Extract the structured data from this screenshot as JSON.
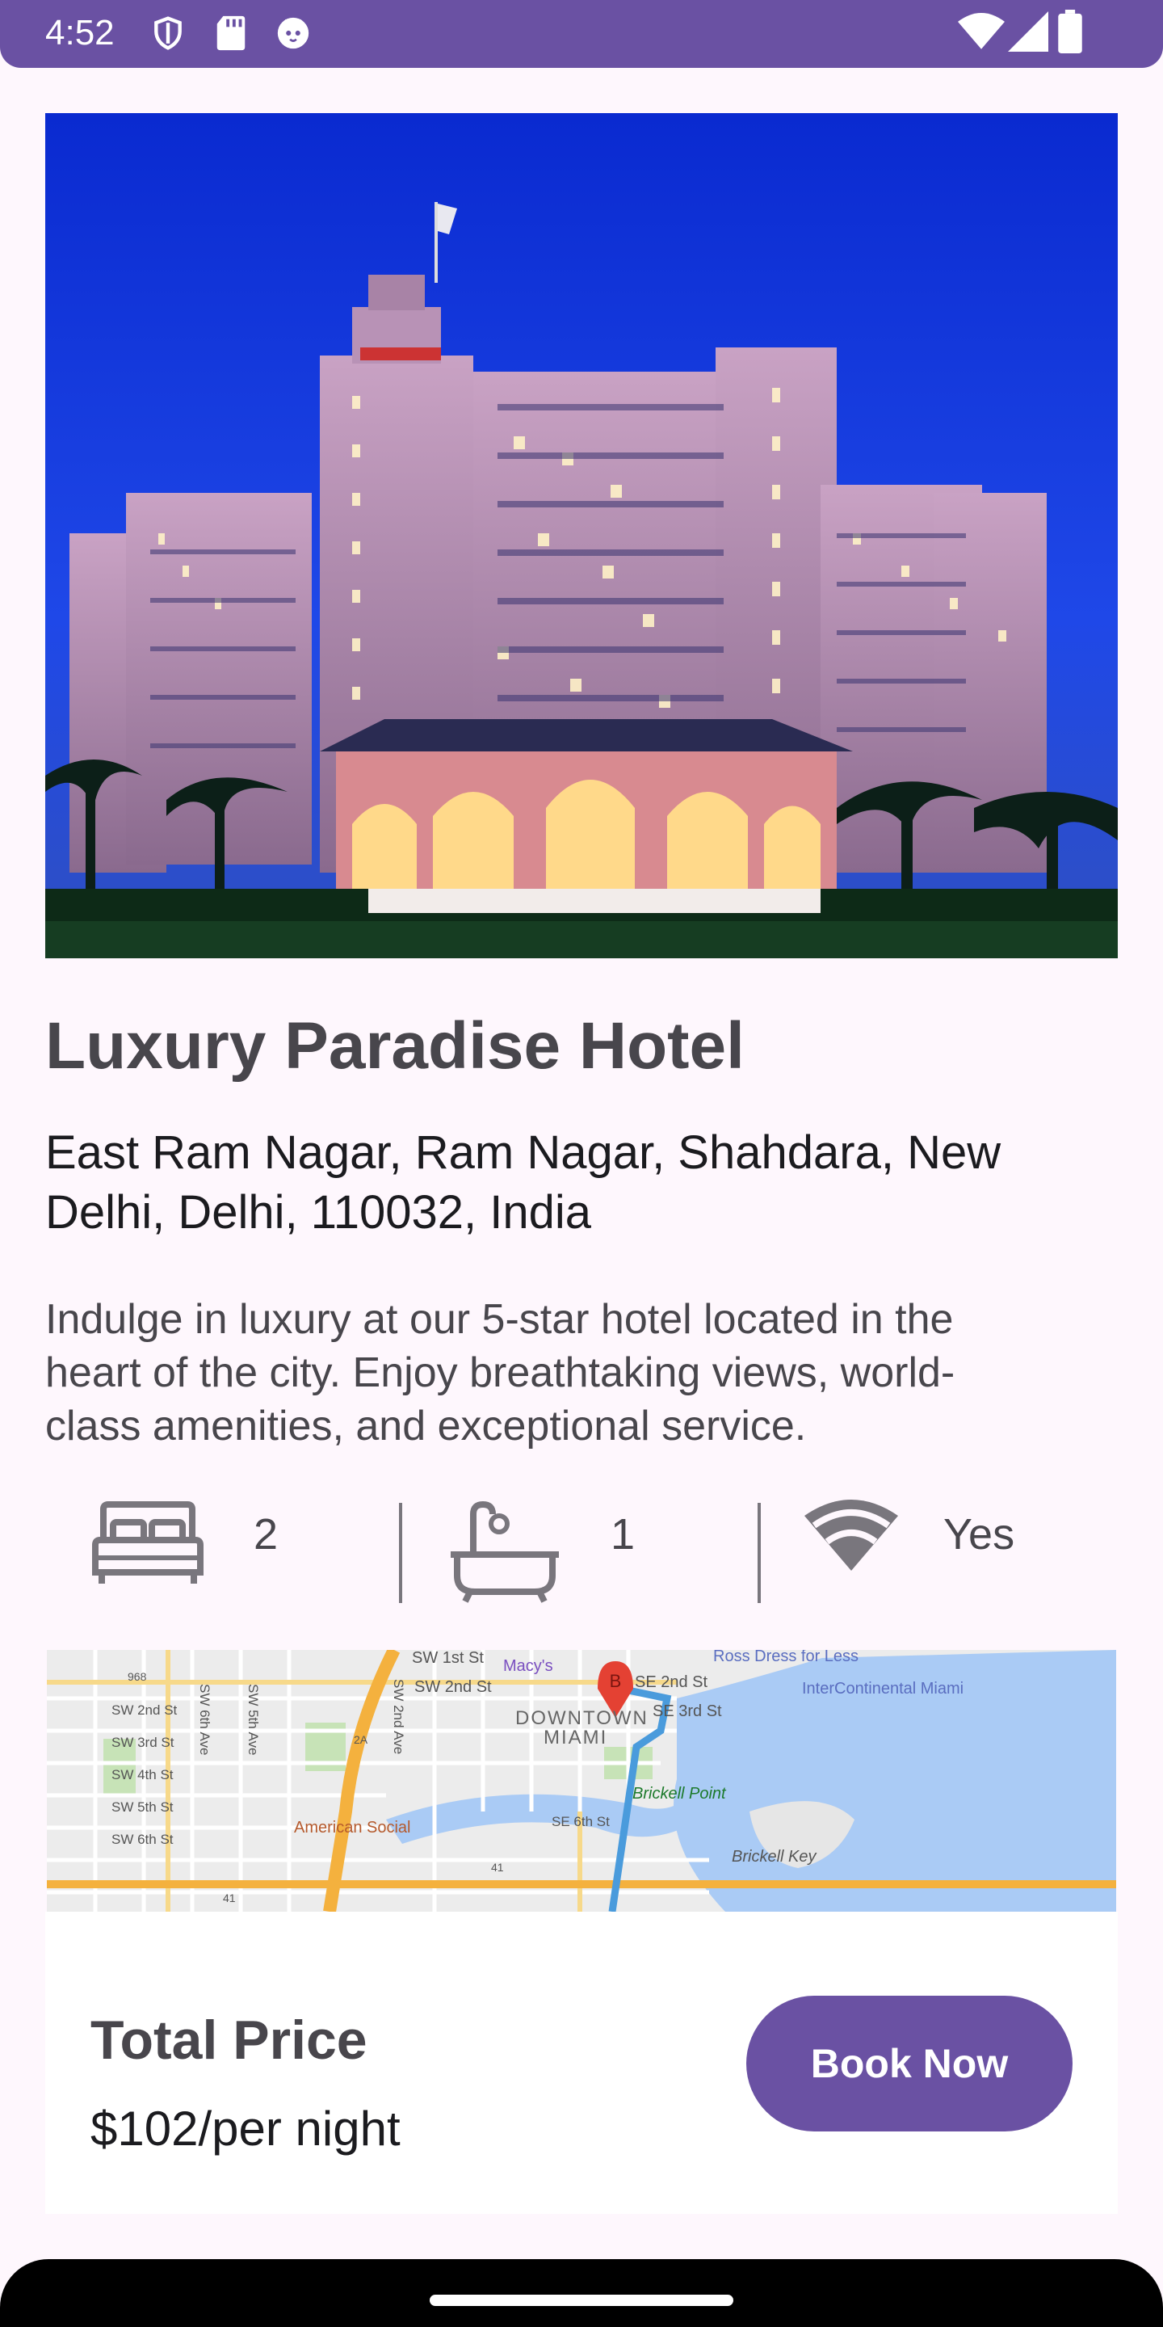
{
  "status_bar": {
    "time": "4:52",
    "left_icons": [
      "shield-icon",
      "sd-card-icon",
      "cat-face-icon"
    ],
    "right_icons": [
      "wifi-icon",
      "cellular-signal-icon",
      "battery-icon"
    ],
    "background": "#6a51a3"
  },
  "hotel": {
    "image": "hotel-photo",
    "name": "Luxury Paradise Hotel",
    "address": "East Ram Nagar, Ram Nagar, Shahdara, New Delhi, Delhi, 110032, India",
    "description": "Indulge in luxury at our 5-star hotel located in the heart of the city. Enjoy breathtaking views, world-class amenities, and exceptional service."
  },
  "amenities": [
    {
      "icon": "bed-icon",
      "value": "2"
    },
    {
      "icon": "bathtub-icon",
      "value": "1"
    },
    {
      "icon": "wifi-icon",
      "value": "Yes"
    }
  ],
  "map": {
    "labels": {
      "sw1st": "SW 1st St",
      "sw2nd_top": "SW 2nd St",
      "macys": "Macy's",
      "ross": "Ross Dress for Less",
      "se2nd": "SE 2nd St",
      "intercontinental": "InterContinental Miami",
      "se3rd": "SE 3rd St",
      "downtown": "DOWNTOWN",
      "miami": "MIAMI",
      "sw2nd": "SW 2nd St",
      "sw3rd": "SW 3rd St",
      "sw4th": "SW 4th St",
      "sw5th": "SW 5th St",
      "sw6th": "SW 6th St",
      "sw6th_ave": "SW 6th Ave",
      "sw5th_ave": "SW 5th Ave",
      "sw2nd_ave": "SW 2nd Ave",
      "brickell_point": "Brickell Point",
      "american_social": "American Social",
      "se6th": "SE 6th St",
      "brickell_key": "Brickell Key",
      "route_968": "968",
      "route_2a": "2A",
      "route_41a": "41",
      "route_41b": "41",
      "marker": "B"
    }
  },
  "booking": {
    "price_label": "Total Price",
    "price": "$102/per night",
    "button_label": "Book Now",
    "accent": "#6a51a3"
  }
}
